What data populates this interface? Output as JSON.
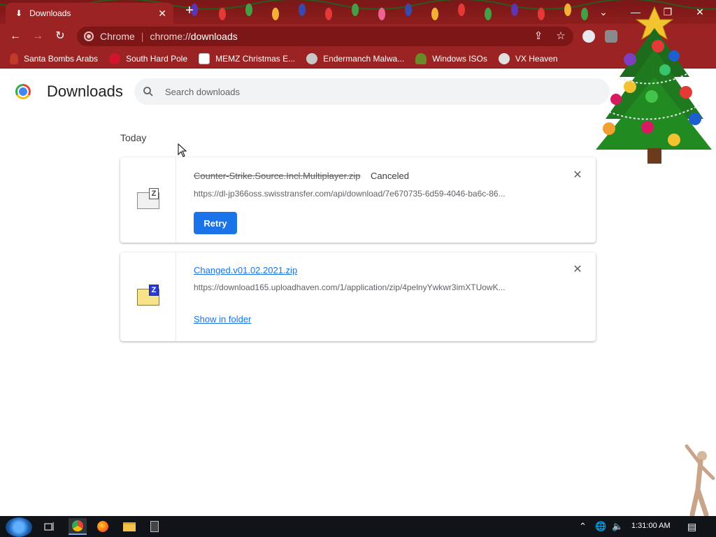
{
  "window": {
    "tab_title": "Downloads",
    "controls": {
      "minimize": "—",
      "maximize": "❐",
      "close": "✕"
    }
  },
  "toolbar": {
    "site_label": "Chrome",
    "url_scheme": "chrome://",
    "url_host": "downloads"
  },
  "bookmarks": [
    {
      "label": "Santa Bombs Arabs",
      "icon": "santa-icon",
      "color": "#c0392b"
    },
    {
      "label": "South Hard Pole",
      "icon": "virus-icon",
      "color": "#d0142c"
    },
    {
      "label": "MEMZ Christmas E...",
      "icon": "image-icon",
      "color": "#ffffff"
    },
    {
      "label": "Endermanch Malwa...",
      "icon": "raccoon-icon",
      "color": "#c8c8c8"
    },
    {
      "label": "Windows ISOs",
      "icon": "grinch-icon",
      "color": "#6a8a2a"
    },
    {
      "label": "VX Heaven",
      "icon": "vx-icon",
      "color": "#e0e0e0"
    }
  ],
  "page": {
    "title": "Downloads",
    "search_placeholder": "Search downloads",
    "date_heading": "Today"
  },
  "downloads": [
    {
      "file_name": "Counter-Strike.Source.Incl.Multiplayer.zip",
      "status": "Canceled",
      "url": "https://dl-jp366oss.swisstransfer.com/api/download/7e670735-6d59-4046-ba6c-86...",
      "action_label": "Retry",
      "state": "canceled"
    },
    {
      "file_name": "Changed.v01.02.2021.zip",
      "status": "",
      "url": "https://download165.uploadhaven.com/1/application/zip/4pelnyYwkwr3imXTUowK...",
      "action_label": "Show in folder",
      "state": "complete"
    }
  ],
  "taskbar": {
    "clock": "1:31:00 AM"
  },
  "colors": {
    "chrome_red": "#9b2323",
    "accent_blue": "#1a73e8"
  }
}
